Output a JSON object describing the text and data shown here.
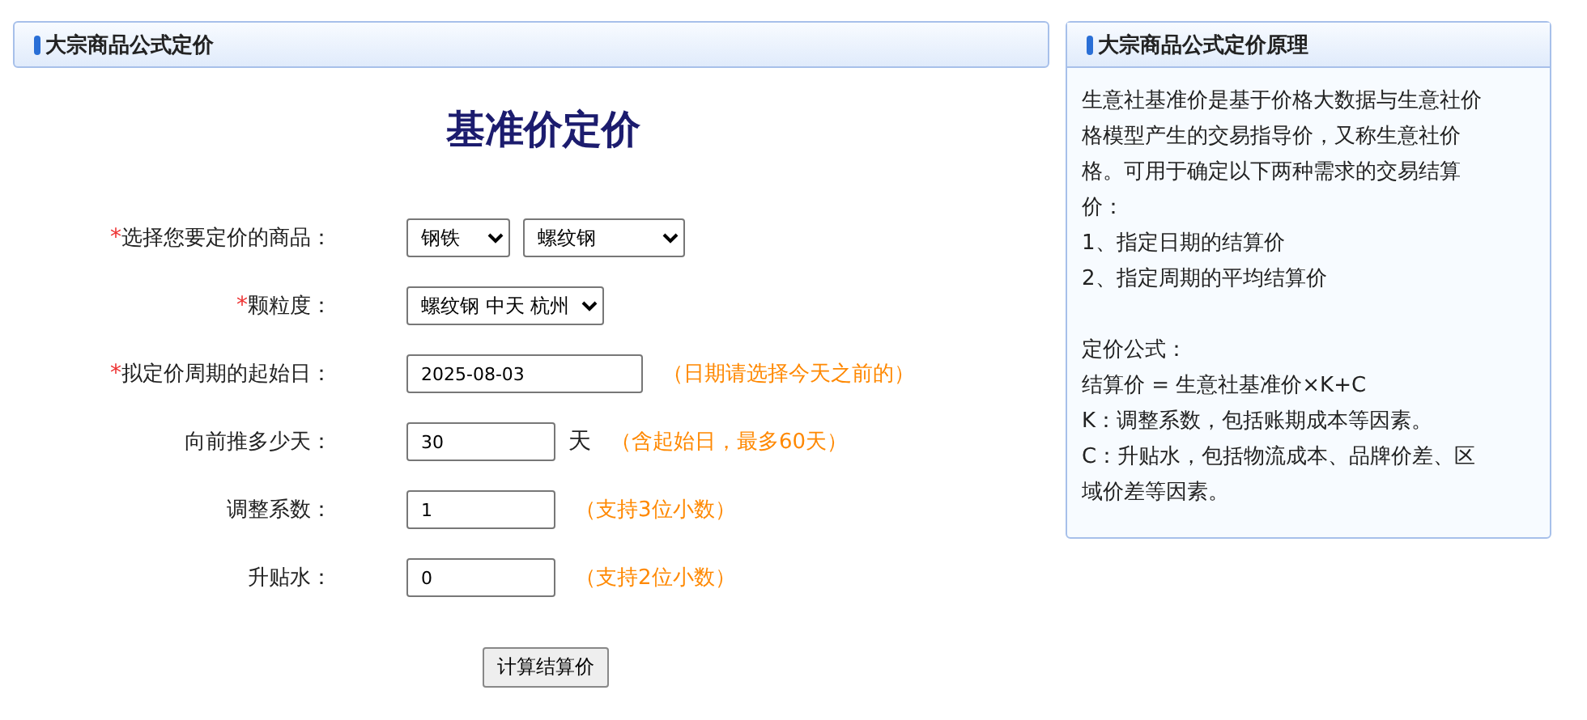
{
  "form_panel": {
    "title": "大宗商品公式定价",
    "heading": "基准价定价",
    "rows": [
      {
        "label": "选择您要定价的商品：",
        "mark": "*",
        "kind": "select",
        "selects": [
          "钢铁",
          "螺纹钢"
        ]
      },
      {
        "label": "颗粒度：",
        "mark": "*",
        "kind": "select",
        "selects": [
          "螺纹钢 中天 杭州"
        ]
      },
      {
        "label": "拟定价周期的起始日：",
        "mark": "*",
        "kind": "input",
        "value": "2025-08-03",
        "hint": "（日期请选择今天之前的）"
      },
      {
        "label": "向前推多少天：",
        "kind": "input",
        "value": "30",
        "unit": "天",
        "hint": "（含起始日，最多60天）"
      },
      {
        "label": "调整系数：",
        "kind": "input",
        "value": "1",
        "hint": "（支持3位小数）"
      },
      {
        "label": "升贴水：",
        "kind": "input",
        "value": "0",
        "hint": "（支持2位小数）"
      }
    ],
    "button": "计算结算价"
  },
  "info_panel": {
    "title": "大宗商品公式定价原理",
    "groups": [
      [
        "生意社基准价是基于价格大数据与生意社价格模型产生的交易指导价，又称生意社价格。可用于确定以下两种需求的交易结算价：",
        "1、指定日期的结算价",
        "2、指定周期的平均结算价"
      ],
      [
        "定价公式：",
        "结算价 = 生意社基准价×K+C",
        "K：调整系数，包括账期成本等因素。",
        "C：升贴水，包括物流成本、品牌价差、区域价差等因素。"
      ]
    ]
  }
}
